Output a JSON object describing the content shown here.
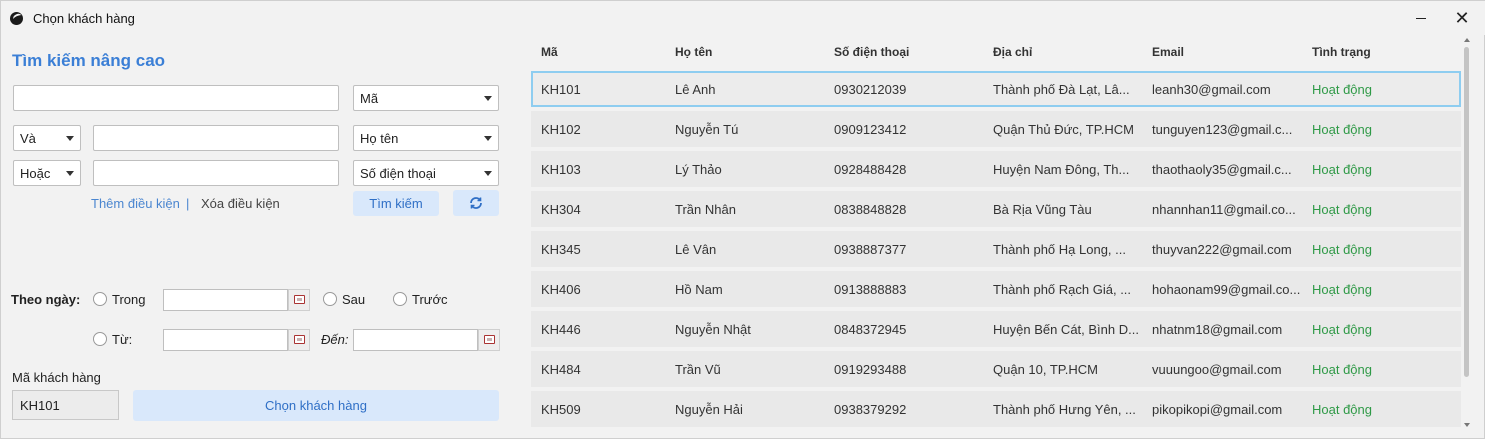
{
  "window": {
    "title": "Chọn khách hàng",
    "close_glyph": "✕"
  },
  "search": {
    "title": "Tìm kiếm nâng cao",
    "main_input_value": "",
    "main_field": "Mã",
    "cond1_op": "Và",
    "cond1_value": "",
    "cond1_field": "Họ tên",
    "cond2_op": "Hoặc",
    "cond2_value": "",
    "cond2_field": "Số điện thoại",
    "add_condition": "Thêm điều kiện",
    "separator": "|",
    "remove_condition": "Xóa điều kiện",
    "search_button": "Tìm kiếm",
    "refresh_icon": "refresh-icon"
  },
  "date_filter": {
    "label": "Theo ngày:",
    "opt_within": "Trong",
    "opt_after": "Sau",
    "opt_before": "Trước",
    "opt_from": "Từ:",
    "to_label": "Đến:",
    "within_value": "",
    "from_value": "",
    "to_value": ""
  },
  "selection": {
    "label": "Mã khách hàng",
    "value": "KH101",
    "choose_button": "Chọn khách hàng"
  },
  "table": {
    "headers": [
      "Mã",
      "Họ tên",
      "Số điện thoại",
      "Địa chỉ",
      "Email",
      "Tình trạng"
    ],
    "rows": [
      {
        "id": "KH101",
        "name": "Lê Anh",
        "phone": "0930212039",
        "address": "Thành phố Đà Lạt, Lâ...",
        "email": "leanh30@gmail.com",
        "status": "Hoạt động"
      },
      {
        "id": "KH102",
        "name": "Nguyễn Tú",
        "phone": "0909123412",
        "address": "Quận Thủ Đức, TP.HCM",
        "email": "tunguyen123@gmail.c...",
        "status": "Hoạt động"
      },
      {
        "id": "KH103",
        "name": "Lý Thảo",
        "phone": "0928488428",
        "address": "Huyện Nam Đông, Th...",
        "email": "thaothaoly35@gmail.c...",
        "status": "Hoạt động"
      },
      {
        "id": "KH304",
        "name": "Trần Nhân",
        "phone": "0838848828",
        "address": "Bà Rịa Vũng Tàu",
        "email": "nhannhan11@gmail.co...",
        "status": "Hoạt động"
      },
      {
        "id": "KH345",
        "name": "Lê Vân",
        "phone": "0938887377",
        "address": "Thành phố Hạ Long, ...",
        "email": "thuyvan222@gmail.com",
        "status": "Hoạt động"
      },
      {
        "id": "KH406",
        "name": "Hồ Nam",
        "phone": "0913888883",
        "address": "Thành phố Rạch Giá, ...",
        "email": "hohaonam99@gmail.co...",
        "status": "Hoạt động"
      },
      {
        "id": "KH446",
        "name": "Nguyễn Nhật",
        "phone": "0848372945",
        "address": "Huyện Bến Cát, Bình D...",
        "email": "nhatnm18@gmail.com",
        "status": "Hoạt động"
      },
      {
        "id": "KH484",
        "name": "Trần Vũ",
        "phone": "0919293488",
        "address": "Quận 10, TP.HCM",
        "email": "vuuungoo@gmail.com",
        "status": "Hoạt động"
      },
      {
        "id": "KH509",
        "name": "Nguyễn Hải",
        "phone": "0938379292",
        "address": "Thành phố Hưng Yên, ...",
        "email": "pikopikopi@gmail.com",
        "status": "Hoạt động"
      }
    ]
  },
  "colors": {
    "accent": "#3b7fd6",
    "status_active": "#2f9a47",
    "selected_border": "#8ecdf0",
    "button_bg": "#d9e8fb"
  }
}
